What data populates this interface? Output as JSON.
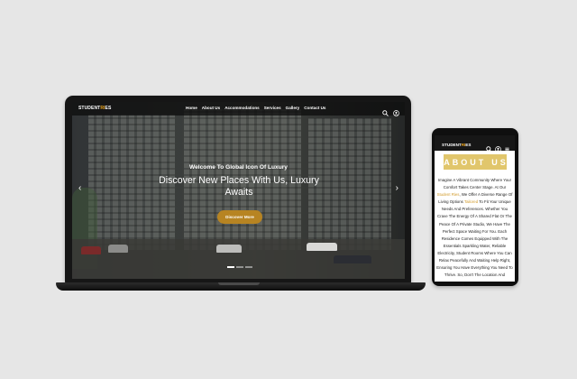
{
  "laptop": {
    "logo": {
      "prefix": "STUDENT",
      "accent": "RI",
      "suffix": "ES"
    },
    "nav": [
      "Home",
      "About Us",
      "Accommodations",
      "Services",
      "Gallery",
      "Contact Us"
    ],
    "icons": {
      "search": "search-icon",
      "account": "user-icon",
      "prev": "chevron-left-icon",
      "next": "chevron-right-icon"
    },
    "hero": {
      "subtitle": "Welcome To Global Icon Of Luxury",
      "title": "Discover New Places With Us, Luxury Awaits",
      "button": "Discover More",
      "slides": 3,
      "active_slide": 1
    }
  },
  "phone": {
    "logo": {
      "prefix": "STUDENT",
      "accent": "RI",
      "suffix": "ES"
    },
    "icons": {
      "search": "search-icon",
      "account": "user-icon",
      "menu": "menu-icon"
    },
    "heading_letters": [
      "A",
      "B",
      "O",
      "U",
      "T",
      "U",
      "S"
    ],
    "text": {
      "before_1": "Imagine A Vibrant Community Where Your Comfort Takes Center Stage. At Our ",
      "highlight_1": "Student Ries",
      "before_2": ", We Offer A Diverse Range Of Living Options ",
      "highlight_2": "Tailored",
      "after": " To Fit Your Unique Needs And Preferences. Whether You Crave The Energy Of A Shared Flat Or The Peace Of A Private Studio, We Have The Perfect Space Waiting For You. Each Residence Comes Equipped With The Essentials Sparkling Water, Reliable Electricity, Student Rooms Where You Can Relax Peacefully And Waiting Help Right, Ensuring You Have Everything You Need To Thrive. So, Don't The Location And"
    }
  },
  "colors": {
    "accent": "#e6a01b",
    "button": "#b78422",
    "heading_bg": "#e1c66c",
    "page_bg": "#e6e6e6"
  }
}
